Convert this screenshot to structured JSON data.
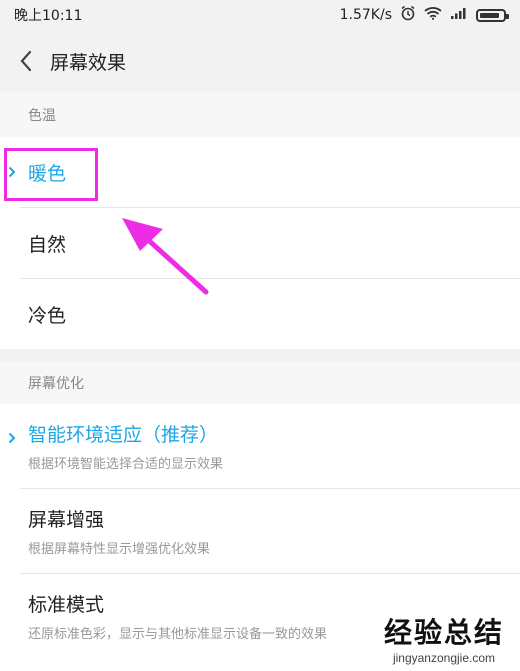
{
  "status_bar": {
    "time": "晚上10:11",
    "network_speed": "1.57K/s",
    "icons": [
      "alarm-icon",
      "wifi-icon",
      "signal-icon",
      "battery-icon"
    ]
  },
  "header": {
    "title": "屏幕效果"
  },
  "color_temp": {
    "section_label": "色温",
    "items": [
      {
        "label": "暖色",
        "selected": true
      },
      {
        "label": "自然",
        "selected": false
      },
      {
        "label": "冷色",
        "selected": false
      }
    ]
  },
  "optimization": {
    "section_label": "屏幕优化",
    "items": [
      {
        "label": "智能环境适应（推荐）",
        "subtitle": "根据环境智能选择合适的显示效果",
        "selected": true
      },
      {
        "label": "屏幕增强",
        "subtitle": "根据屏幕特性显示增强优化效果",
        "selected": false
      },
      {
        "label": "标准模式",
        "subtitle": "还原标准色彩，显示与其他标准显示设备一致的效果",
        "selected": false
      }
    ]
  },
  "watermark": {
    "text": "经验总结",
    "url": "jingyanzongjie.com"
  },
  "colors": {
    "accent": "#1ea7e6",
    "annotation": "#ee2ce6",
    "background": "#f2f2f2"
  }
}
